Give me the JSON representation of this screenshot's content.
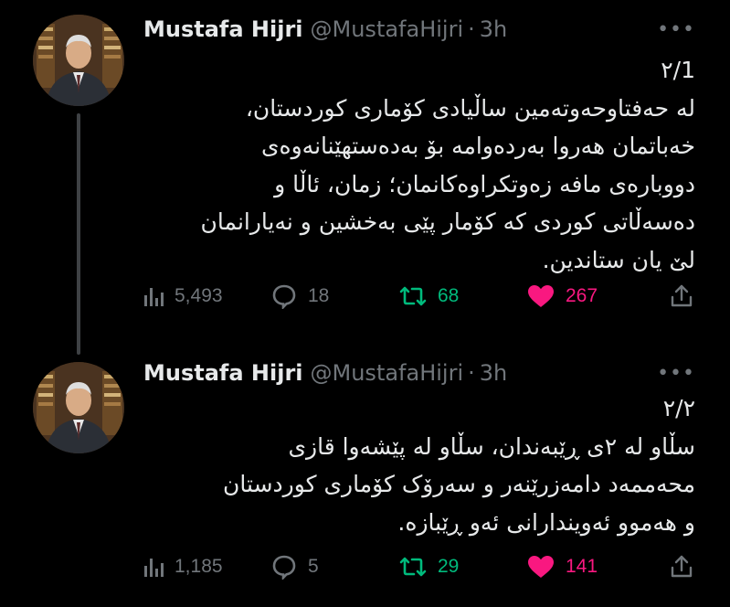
{
  "tweets": [
    {
      "author": {
        "name": "Mustafa Hijri",
        "handle": "@MustafaHijri",
        "time": "3h"
      },
      "more": "•••",
      "lines": [
        "1/٢",
        "لە حەفتاوحەوتەمین ساڵیادی کۆماری کوردستان،",
        "خەباتمان هەروا بەردەوامە بۆ بەدەستهێنانەوەی",
        "دووبارەی مافە زەوتکراوەکانمان؛ زمان، ئاڵا و",
        "دەسەڵاتی کوردی کە کۆمار پێی بەخشین و نەیارانمان",
        "لێ یان ستاندین."
      ],
      "stats": {
        "views": "5,493",
        "replies": "18",
        "reposts": "68",
        "likes": "267"
      }
    },
    {
      "author": {
        "name": "Mustafa Hijri",
        "handle": "@MustafaHijri",
        "time": "3h"
      },
      "more": "•••",
      "lines": [
        "٢/٢",
        "سڵاو لە ٢ی ڕێبەندان، سڵاو لە پێشەوا قازی",
        "محەممەد دامەزرێنەر و سەرۆک کۆماری کوردستان",
        "و هەموو ئەویندارانی ئەو ڕێبازە."
      ],
      "stats": {
        "views": "1,185",
        "replies": "5",
        "reposts": "29",
        "likes": "141"
      }
    }
  ],
  "colors": {
    "repost": "#00ba7c",
    "like": "#f91880",
    "muted": "#71767b",
    "text": "#e7e9ea"
  },
  "icons": [
    "views-icon",
    "reply-icon",
    "repost-icon",
    "heart-icon",
    "share-icon"
  ]
}
